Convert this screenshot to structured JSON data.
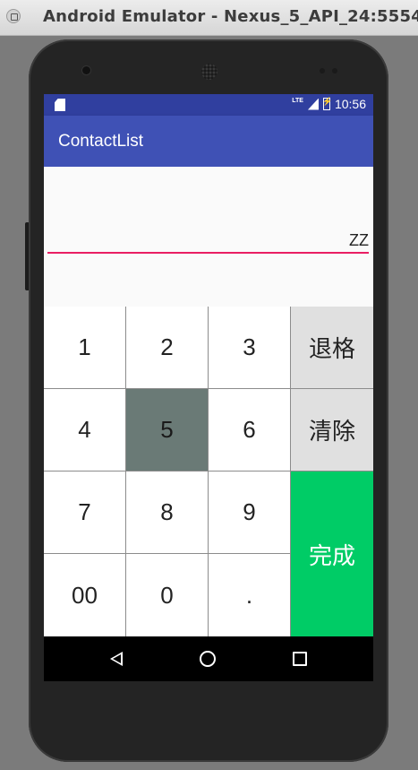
{
  "window": {
    "title": "Android Emulator - Nexus_5_API_24:5554"
  },
  "statusbar": {
    "network": "LTE",
    "time": "10:56",
    "color": "#303f9f"
  },
  "appbar": {
    "title": "ContactList",
    "color": "#3f51b5"
  },
  "input": {
    "value": "ZZ",
    "underline_color": "#e91e63"
  },
  "keypad": {
    "keys": [
      "1",
      "2",
      "3",
      "4",
      "5",
      "6",
      "7",
      "8",
      "9",
      "00",
      "0",
      "."
    ],
    "pressed_key": "5",
    "backspace_label": "退格",
    "clear_label": "清除",
    "done_label": "完成",
    "done_color": "#00cc66"
  },
  "navbar": {
    "icons": [
      "back-icon",
      "home-icon",
      "recents-icon"
    ]
  }
}
